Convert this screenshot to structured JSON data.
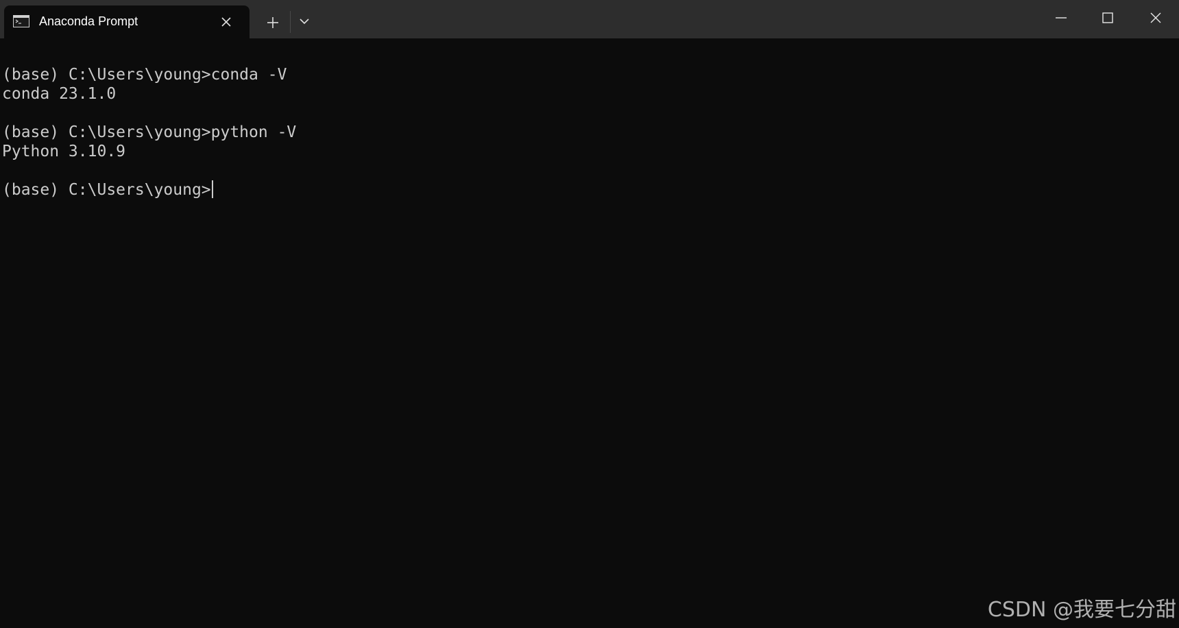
{
  "tab": {
    "title": "Anaconda Prompt",
    "icon": "terminal-icon"
  },
  "titlebar": {
    "new_tab_icon": "plus-icon",
    "dropdown_icon": "chevron-down-icon",
    "minimize_icon": "minimize-icon",
    "maximize_icon": "maximize-icon",
    "close_icon": "close-icon"
  },
  "terminal": {
    "lines": [
      "(base) C:\\Users\\young>conda -V",
      "conda 23.1.0",
      "",
      "(base) C:\\Users\\young>python -V",
      "Python 3.10.9",
      "",
      "(base) C:\\Users\\young>"
    ]
  },
  "watermark": "CSDN @我要七分甜",
  "colors": {
    "background": "#0c0c0c",
    "titlebar": "#2d2d2d",
    "text": "#cccccc"
  }
}
